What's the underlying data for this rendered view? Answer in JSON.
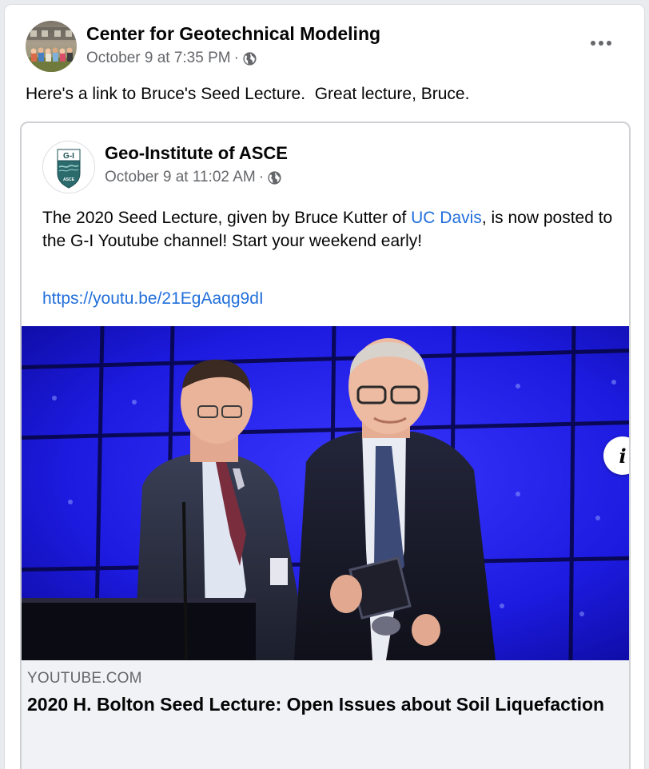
{
  "post": {
    "author": "Center for Geotechnical Modeling",
    "timestamp": "October 9 at 7:35 PM",
    "separator": "·",
    "privacy_icon": "globe-icon",
    "more_icon": "more-horizontal-icon",
    "text": "Here's a link to Bruce's Seed Lecture.  Great lecture, Bruce."
  },
  "shared_post": {
    "author": "Geo-Institute of ASCE",
    "timestamp": "October 9 at 11:02 AM",
    "separator": "·",
    "privacy_icon": "globe-icon",
    "avatar_label": "G-I",
    "avatar_sublabel": "ASCE",
    "text_part1": "The 2020 Seed Lecture, given by Bruce Kutter of ",
    "mention": "UC Davis",
    "text_part2": ", is now posted to the G-I Youtube channel! Start your weekend early!",
    "url": "https://youtu.be/21EgAaqg9dI"
  },
  "link_preview": {
    "domain": "YOUTUBE.COM",
    "title": "2020 H. Bolton Seed Lecture: Open Issues about Soil Liquefaction",
    "info_icon": "info-icon",
    "info_glyph": "i"
  },
  "colors": {
    "link": "#216fdb",
    "meta": "#65676b",
    "stage_blue": "#1a18d8",
    "preview_bg": "#f0f2f5"
  }
}
